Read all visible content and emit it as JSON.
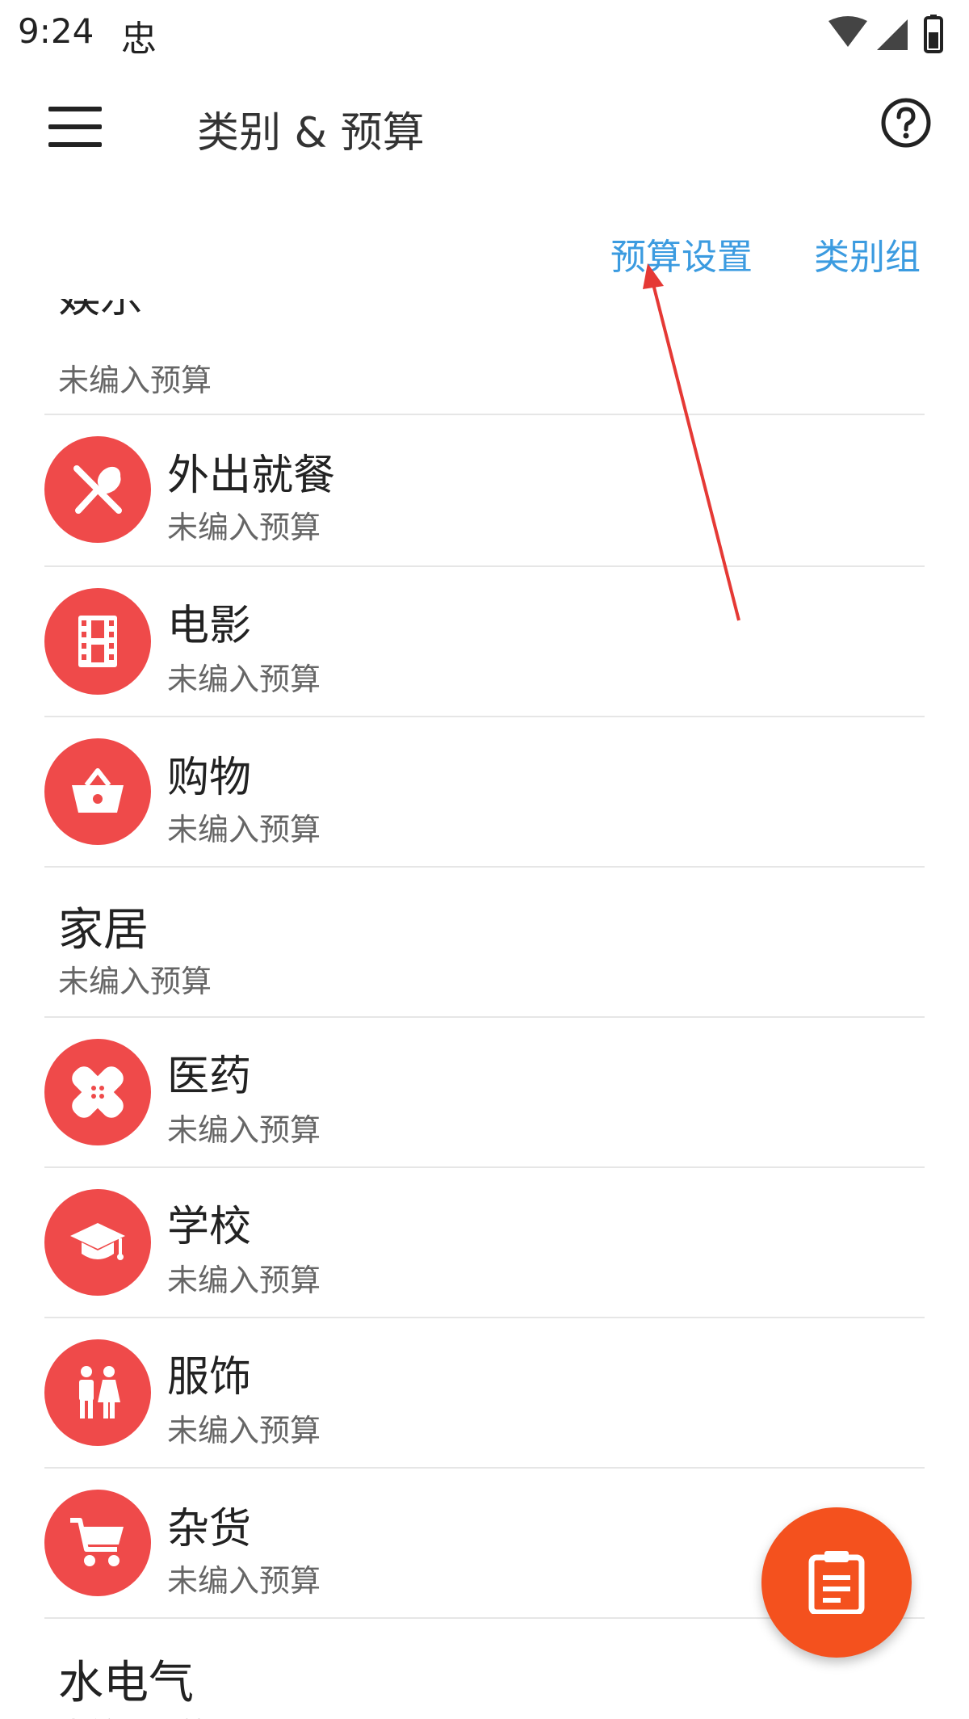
{
  "status_bar": {
    "time": "9:24",
    "notification_glyph": "忠",
    "icons": [
      "wifi-icon",
      "signal-icon",
      "battery-icon"
    ]
  },
  "app_bar": {
    "menu_icon": "menu-icon",
    "title": "类别 & 预算",
    "help_icon": "help-icon"
  },
  "toolbar": {
    "budget_settings_label": "预算设置",
    "category_group_label": "类别组"
  },
  "categories": [
    {
      "title": "娱乐",
      "subtitle": "未编入预算",
      "icon": null,
      "type": "group"
    },
    {
      "title": "外出就餐",
      "subtitle": "未编入预算",
      "icon": "fork-spoon-icon",
      "type": "category"
    },
    {
      "title": "电影",
      "subtitle": "未编入预算",
      "icon": "film-icon",
      "type": "category"
    },
    {
      "title": "购物",
      "subtitle": "未编入预算",
      "icon": "basket-icon",
      "type": "category"
    },
    {
      "title": "家居",
      "subtitle": "未编入预算",
      "icon": null,
      "type": "group"
    },
    {
      "title": "医药",
      "subtitle": "未编入预算",
      "icon": "bandage-icon",
      "type": "category"
    },
    {
      "title": "学校",
      "subtitle": "未编入预算",
      "icon": "graduation-cap-icon",
      "type": "category"
    },
    {
      "title": "服饰",
      "subtitle": "未编入预算",
      "icon": "people-icon",
      "type": "category"
    },
    {
      "title": "杂货",
      "subtitle": "未编入预算",
      "icon": "cart-icon",
      "type": "category"
    },
    {
      "title": "水电气",
      "subtitle": "未编入预算",
      "icon": null,
      "type": "group"
    }
  ],
  "fab": {
    "icon": "clipboard-icon"
  },
  "colors": {
    "accent_link": "#3b9be0",
    "category_icon_bg": "#ef4a4a",
    "fab_bg": "#f4511e",
    "annotation_arrow": "#e53935"
  }
}
